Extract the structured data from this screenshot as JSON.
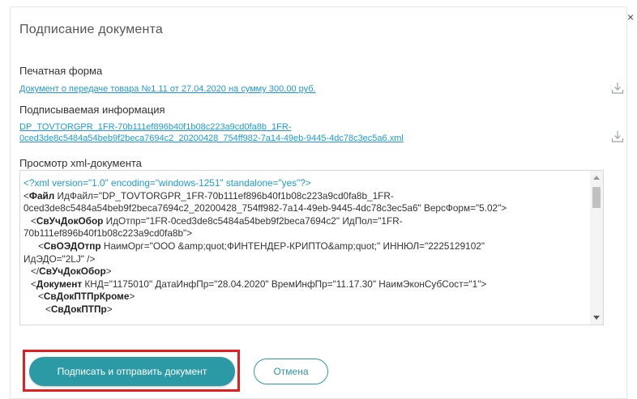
{
  "dialog": {
    "title": "Подписание документа",
    "close_glyph": "×"
  },
  "print_form": {
    "label": "Печатная форма",
    "link": "Документ о передаче товара №1.11 от 27.04.2020 на сумму 300,00 руб.",
    "download_icon": "download-icon"
  },
  "signed_info": {
    "label": "Подписываемая информация",
    "link_line1": "DP_TOVTORGPR_1FR-70b111ef896b40f1b08c223a9cd0fa8b_1FR-",
    "link_line2": "0ced3de8c5484a54beb9f2beca7694c2_20200428_754ff982-7a14-49eb-9445-4dc78c3ec5a6.xml",
    "download_icon": "download-icon"
  },
  "xml_view": {
    "label": "Просмотр xml-документа",
    "lines": [
      {
        "indent": 0,
        "tag": "",
        "text": "<?xml version=\"1.0\" encoding=\"windows-1251\" standalone=\"yes\"?>",
        "blue": true
      },
      {
        "indent": 0,
        "tag": "Файл",
        "open": "<",
        "text": " ИдФайл=\"DP_TOVTORGPR_1FR-70b111ef896b40f1b08c223a9cd0fa8b_1FR-"
      },
      {
        "indent": 0,
        "tag": "",
        "open": "",
        "text": "0ced3de8c5484a54beb9f2beca7694c2_20200428_754ff982-7a14-49eb-9445-4dc78c3ec5a6\" ВерсФорм=\"5.02\">"
      },
      {
        "indent": 1,
        "tag": "СвУчДокОбор",
        "open": "<",
        "text": " ИдОтпр=\"1FR-0ced3de8c5484a54beb9f2beca7694c2\" ИдПол=\"1FR-"
      },
      {
        "indent": 0,
        "tag": "",
        "open": "",
        "text": "70b111ef896b40f1b08c223a9cd0fa8b\">"
      },
      {
        "indent": 2,
        "tag": "СвОЭДОтпр",
        "open": "<",
        "text": " НаимОрг=\"ООО &amp;quot;ФИНТЕНДЕР-КРИПТО&amp;quot;\" ИННЮЛ=\"2225129102\""
      },
      {
        "indent": 0,
        "tag": "",
        "open": "",
        "text": "ИдЭДО=\"2LJ\" />"
      },
      {
        "indent": 1,
        "tag": "СвУчДокОбор",
        "open": "</",
        "text": ">"
      },
      {
        "indent": 1,
        "tag": "Документ",
        "open": "<",
        "text": " КНД=\"1175010\" ДатаИнфПр=\"28.04.2020\" ВремИнфПр=\"11.17.30\" НаимЭконСубСост=\"1\">"
      },
      {
        "indent": 2,
        "tag": "СвДокПТПрКроме",
        "open": "<",
        "text": ">"
      },
      {
        "indent": 3,
        "tag": "СвДокПТПр",
        "open": "<",
        "text": ">"
      }
    ]
  },
  "actions": {
    "submit_label": "Подписать и отправить документ",
    "cancel_label": "Отмена"
  },
  "colors": {
    "accent": "#2c9aa5",
    "link": "#1e9bd7",
    "highlight": "#e02020"
  }
}
